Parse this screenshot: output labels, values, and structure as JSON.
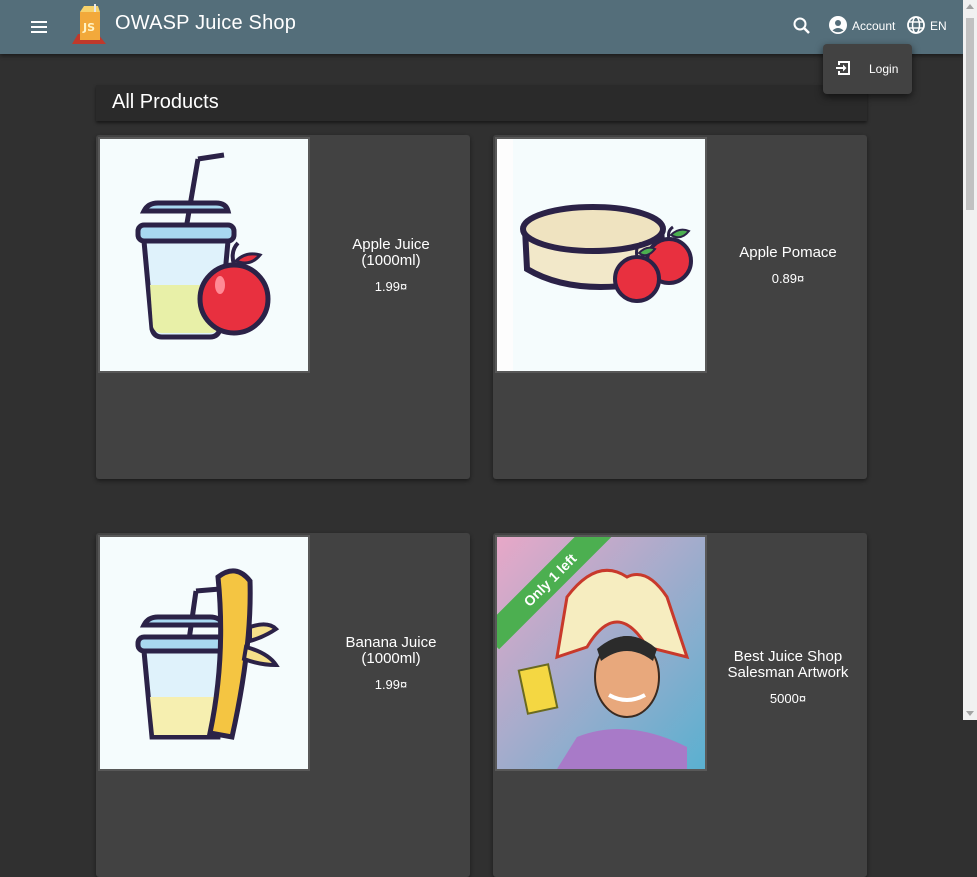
{
  "header": {
    "app_title": "OWASP Juice Shop",
    "account_label": "Account",
    "language_label": "EN"
  },
  "account_menu": {
    "login_label": "Login"
  },
  "page": {
    "heading": "All Products"
  },
  "products": [
    {
      "name": "Apple Juice\n(1000ml)",
      "price": "1.99¤",
      "icon": "apple-juice-image"
    },
    {
      "name": "Apple Pomace",
      "price": "0.89¤",
      "icon": "apple-pomace-image"
    },
    {
      "name": "Banana Juice\n(1000ml)",
      "price": "1.99¤",
      "icon": "banana-juice-image"
    },
    {
      "name": "Best Juice Shop\nSalesman Artwork",
      "price": "5000¤",
      "icon": "salesman-artwork-image",
      "ribbon": "Only 1 left"
    }
  ],
  "colors": {
    "toolbar": "#546e7a",
    "background": "#303030",
    "card": "#424242",
    "ribbon": "#4caf50"
  }
}
